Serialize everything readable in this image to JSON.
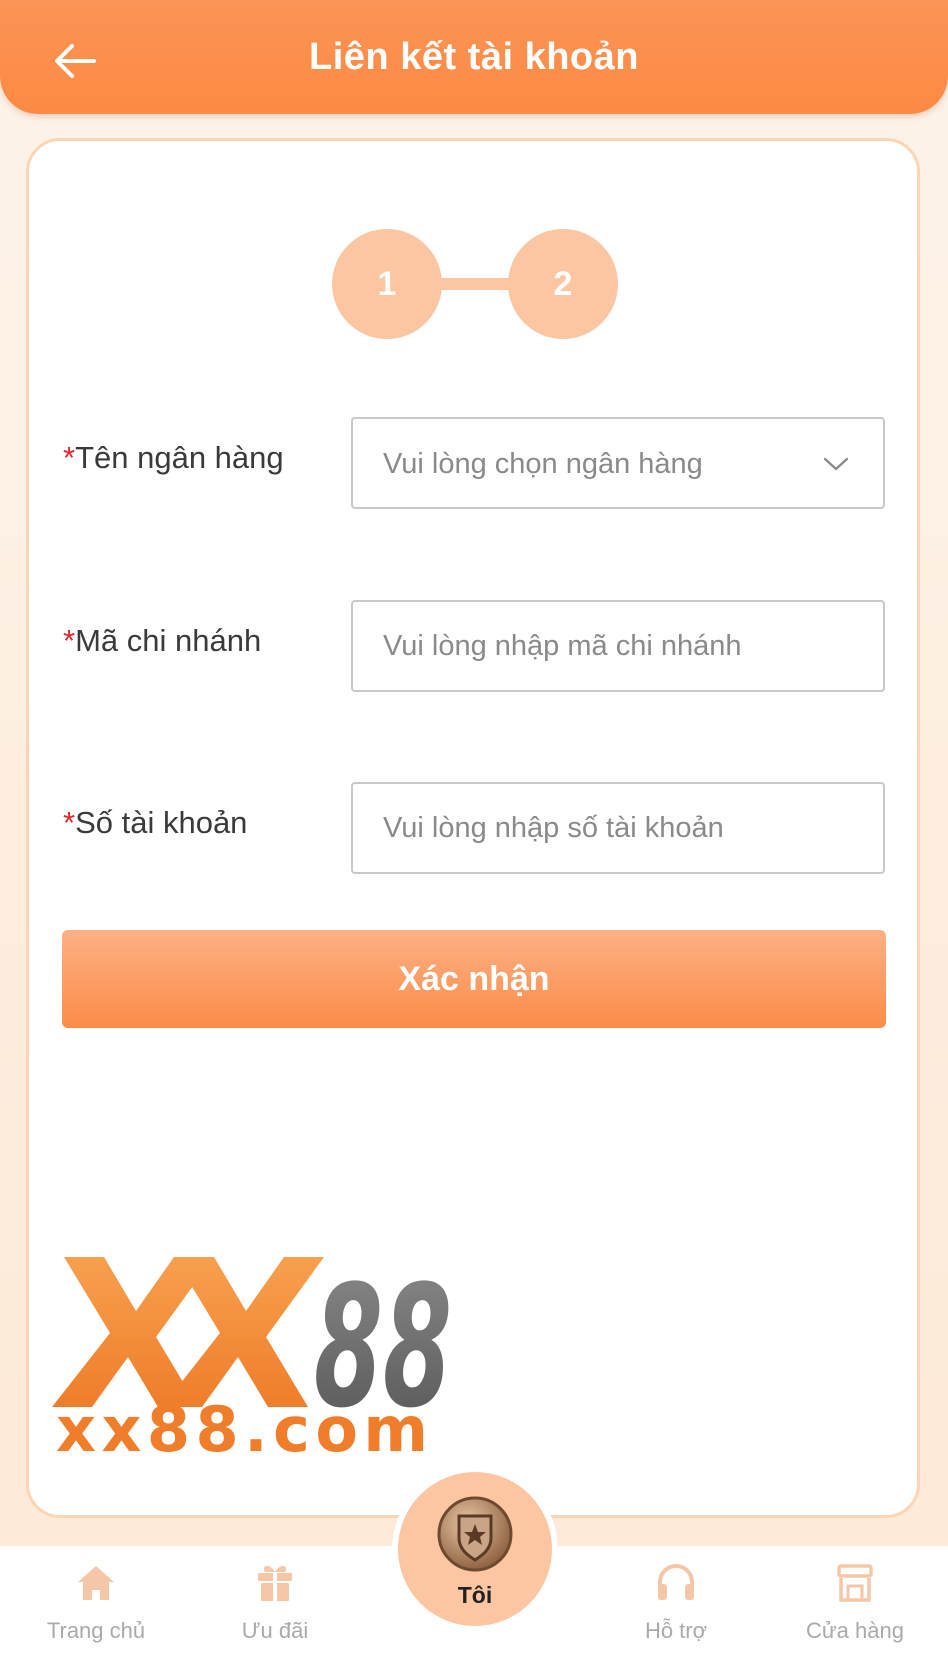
{
  "header": {
    "title": "Liên kết tài khoản"
  },
  "steps": [
    "1",
    "2"
  ],
  "form": {
    "required_mark": "*",
    "bank": {
      "label": "Tên ngân hàng",
      "placeholder": "Vui lòng chọn ngân hàng"
    },
    "branch": {
      "label": "Mã chi nhánh",
      "placeholder": "Vui lòng nhập mã chi nhánh"
    },
    "account": {
      "label": "Số tài khoản",
      "placeholder": "Vui lòng nhập số tài khoản"
    },
    "submit_label": "Xác nhận"
  },
  "logo": {
    "brand": "XX88",
    "domain": "xx88.com"
  },
  "nav": {
    "home": "Trang chủ",
    "promo": "Ưu đãi",
    "me": "Tôi",
    "support": "Hỗ trợ",
    "store": "Cửa hàng"
  },
  "colors": {
    "accent": "#fc8a43",
    "step": "#fcc6a2",
    "required": "#e5242c"
  }
}
